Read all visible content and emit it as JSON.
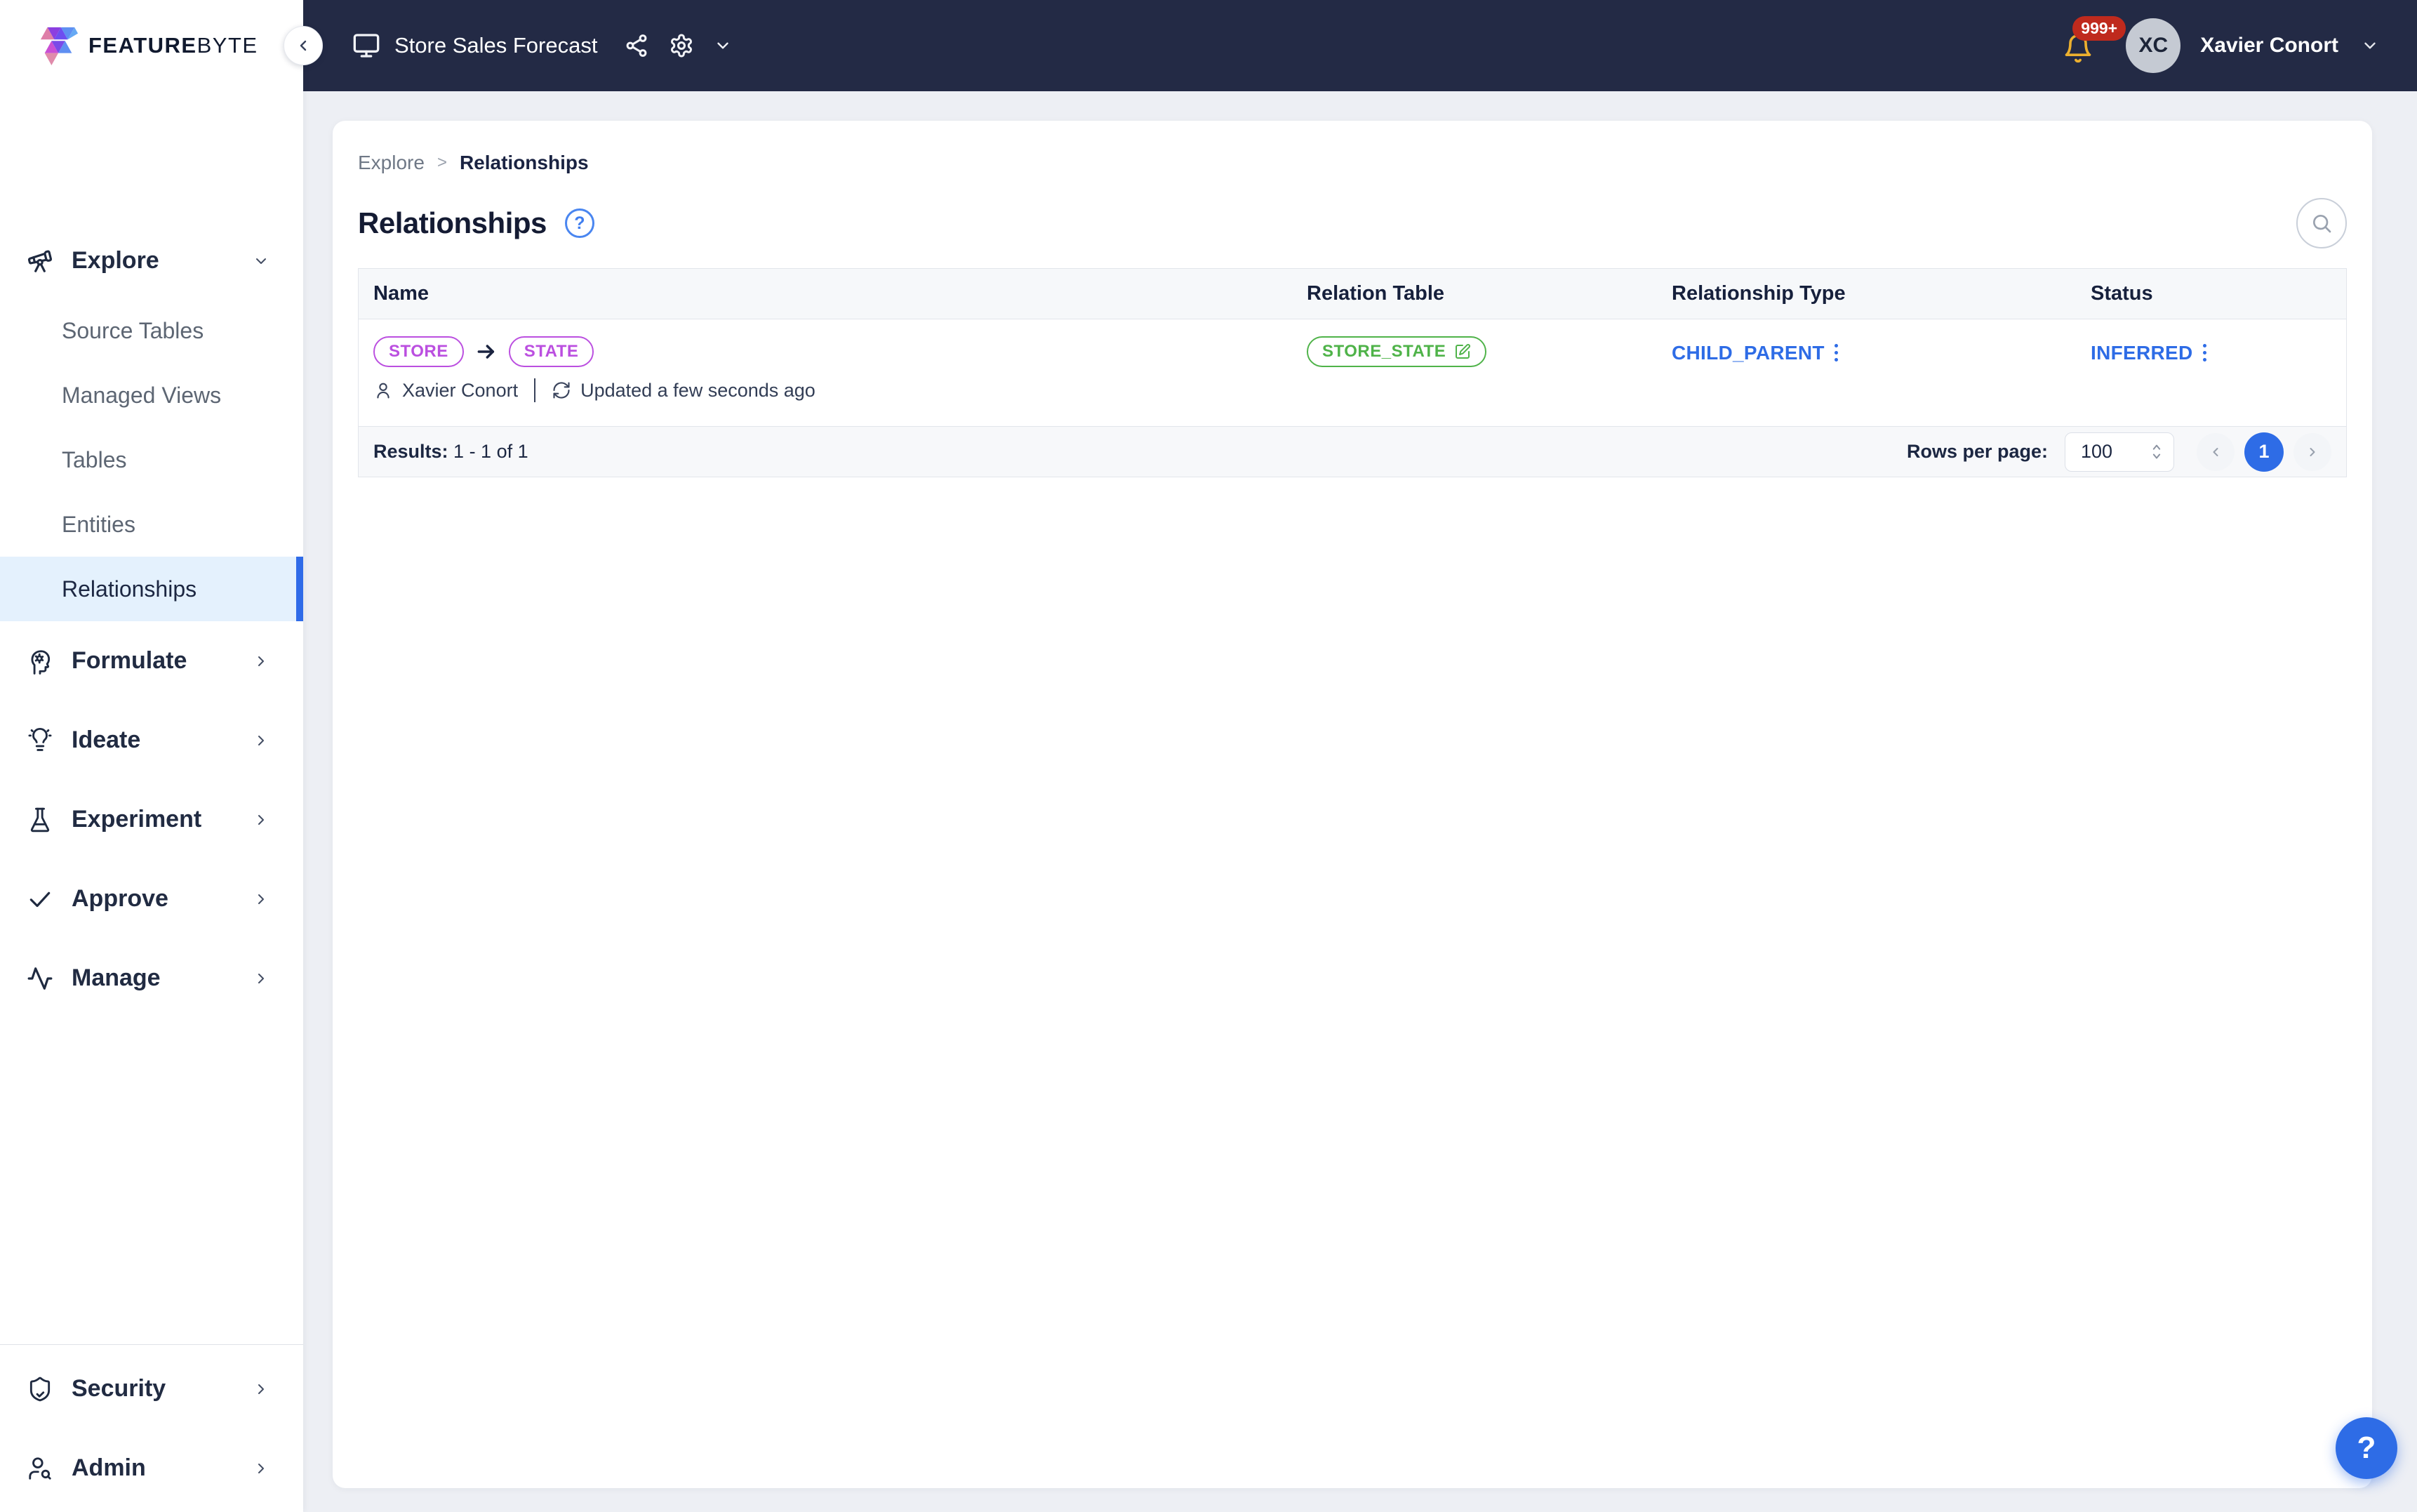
{
  "brand": {
    "feature": "FEATURE",
    "byte": "BYTE"
  },
  "topbar": {
    "project_name": "Store Sales Forecast",
    "notification_count": "999+",
    "user_initials": "XC",
    "user_name": "Xavier Conort"
  },
  "sidebar": {
    "explore": {
      "label": "Explore",
      "children": [
        {
          "label": "Source Tables"
        },
        {
          "label": "Managed Views"
        },
        {
          "label": "Tables"
        },
        {
          "label": "Entities"
        },
        {
          "label": "Relationships",
          "active": true
        }
      ]
    },
    "sections": [
      {
        "label": "Formulate",
        "icon": "head-gear-icon"
      },
      {
        "label": "Ideate",
        "icon": "lightbulb-icon"
      },
      {
        "label": "Experiment",
        "icon": "flask-icon"
      },
      {
        "label": "Approve",
        "icon": "check-icon"
      },
      {
        "label": "Manage",
        "icon": "activity-icon"
      }
    ],
    "footer": [
      {
        "label": "Security",
        "icon": "shield-check-icon"
      },
      {
        "label": "Admin",
        "icon": "user-search-icon"
      }
    ]
  },
  "breadcrumb": {
    "parent": "Explore",
    "current": "Relationships"
  },
  "page": {
    "title": "Relationships",
    "help_glyph": "?"
  },
  "table": {
    "columns": [
      "Name",
      "Relation Table",
      "Relationship Type",
      "Status"
    ],
    "row": {
      "from_entity": "STORE",
      "to_entity": "STATE",
      "owner": "Xavier Conort",
      "updated": "Updated a few seconds ago",
      "relation_table": "STORE_STATE",
      "relationship_type": "CHILD_PARENT",
      "status": "INFERRED"
    },
    "footer": {
      "results_label": "Results:",
      "results_value": "1 - 1 of 1",
      "rows_per_page_label": "Rows per page:",
      "rows_per_page_value": "100",
      "current_page": "1"
    }
  },
  "fab": {
    "label": "?"
  },
  "colors": {
    "topbar_bg": "#232a45",
    "accent_blue": "#2e6ce6",
    "active_item_bg": "#e4f1fd",
    "entity_purple": "#bb4fe0",
    "table_green": "#4fb349",
    "bell_gold": "#ecb02f",
    "badge_red": "#bf2a1d",
    "page_bg": "#edeff4",
    "header_bg": "#f6f8fa",
    "border": "#e2e5eb",
    "dark_text": "#141b33"
  }
}
